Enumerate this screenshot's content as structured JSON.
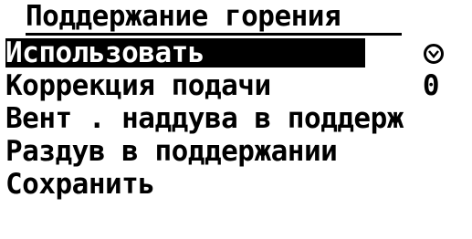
{
  "menu": {
    "title": "Поддержание горения",
    "items": [
      {
        "label": "Использовать",
        "value": "",
        "checked": true,
        "selected": true
      },
      {
        "label": "Коррекция подачи",
        "value": "0"
      },
      {
        "label": "Вент . наддува в поддерж",
        "value": ""
      },
      {
        "label": "Раздув в поддержании",
        "value": ""
      },
      {
        "label": "Сохранить",
        "value": ""
      }
    ]
  },
  "icons": {
    "check": "checkmark-circle-icon"
  }
}
